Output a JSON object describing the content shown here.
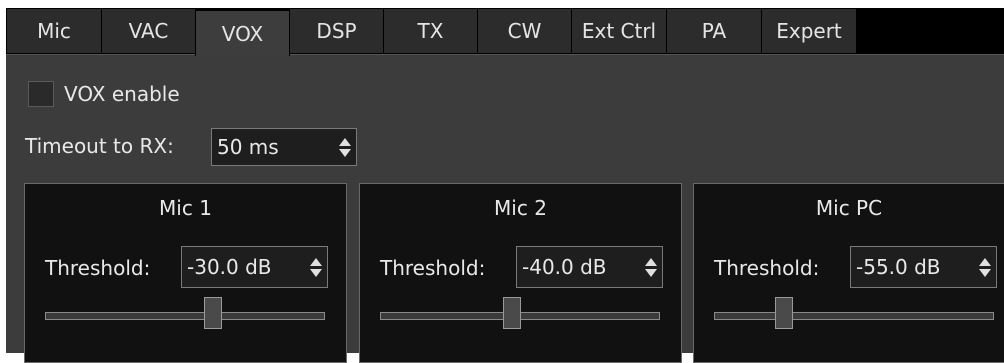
{
  "tabs": [
    {
      "label": "Mic",
      "active": false
    },
    {
      "label": "VAC",
      "active": false
    },
    {
      "label": "VOX",
      "active": true
    },
    {
      "label": "DSP",
      "active": false
    },
    {
      "label": "TX",
      "active": false
    },
    {
      "label": "CW",
      "active": false
    },
    {
      "label": "Ext Ctrl",
      "active": false
    },
    {
      "label": "PA",
      "active": false
    },
    {
      "label": "Expert",
      "active": false
    }
  ],
  "vox": {
    "enable_label": "VOX enable",
    "enable_checked": false,
    "timeout_label": "Timeout to RX:",
    "timeout_value": "50 ms"
  },
  "panels": [
    {
      "title": "Mic 1",
      "threshold_label": "Threshold:",
      "threshold_value": "-30.0 dB",
      "slider_fraction": 0.6
    },
    {
      "title": "Mic 2",
      "threshold_label": "Threshold:",
      "threshold_value": "-40.0 dB",
      "slider_fraction": 0.47
    },
    {
      "title": "Mic PC",
      "threshold_label": "Threshold:",
      "threshold_value": "-55.0 dB",
      "slider_fraction": 0.25
    }
  ],
  "colors": {
    "background": "#3c3c3c",
    "panel": "#111111",
    "tab": "#2c2c2c",
    "active_tab": "#3d3d3d",
    "text": "#e8e8e8"
  }
}
